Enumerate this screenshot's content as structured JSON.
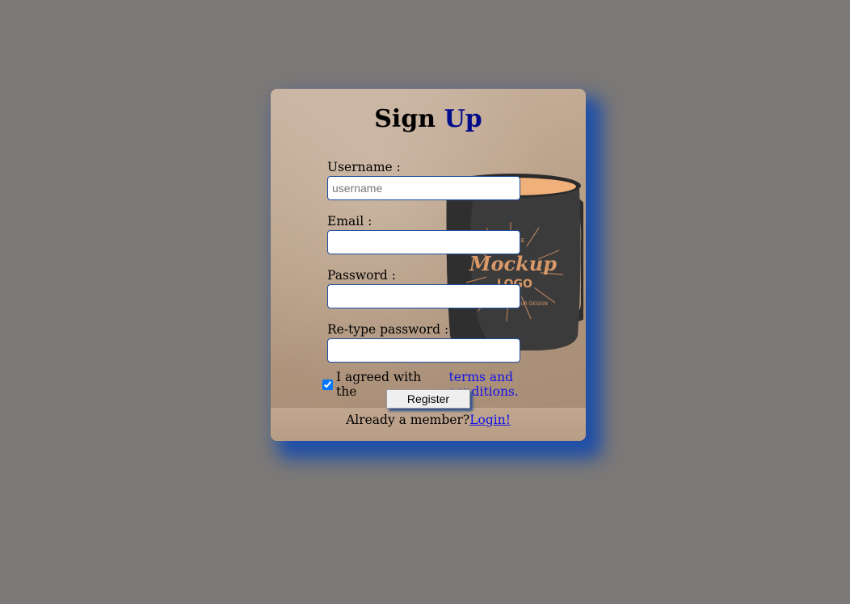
{
  "form": {
    "title_part1": "Sign",
    "title_part2": "Up",
    "username_label": "Username :",
    "username_placeholder": "username",
    "username_value": "",
    "email_label": "Email :",
    "email_value": "",
    "password_label": "Password :",
    "password_value": "",
    "retype_label": "Re-type password :",
    "retype_value": "",
    "agree_text": "I agreed with the",
    "terms_link": "terms and conditions.",
    "agree_checked": true,
    "register_label": "Register",
    "member_text": "Already a member?",
    "login_link": "Login!"
  },
  "background_image": {
    "mug_text_main": "Mockup",
    "mug_text_sub": "LOGO",
    "mug_text_top": "PLE",
    "mug_text_bottom": "YOUR DESIGN"
  },
  "colors": {
    "page_bg": "#7b7877",
    "card_shadow": "#1f4fa8",
    "title_accent": "#000c8a",
    "link": "#1212e8"
  }
}
